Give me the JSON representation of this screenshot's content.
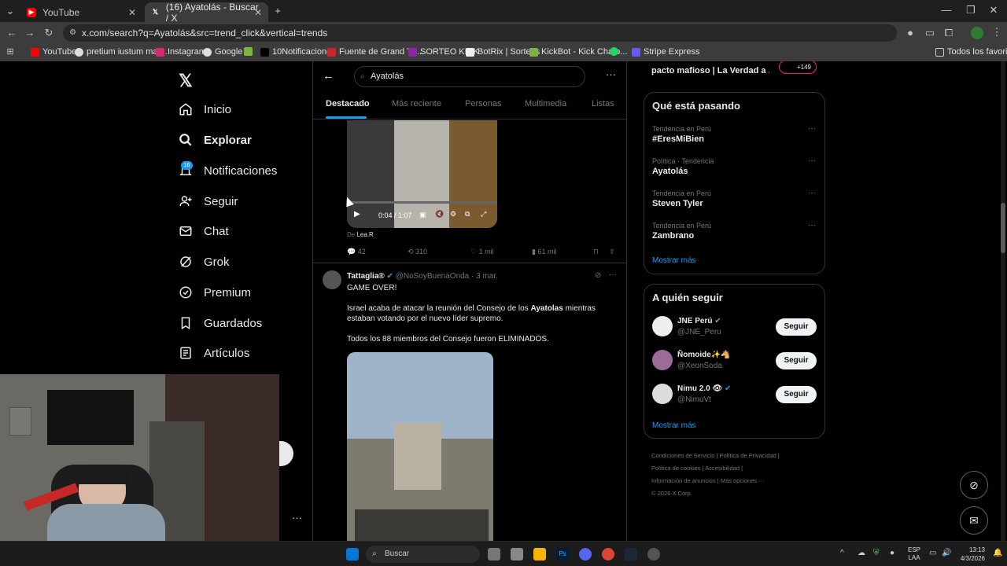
{
  "browser": {
    "tabs": [
      {
        "label": "YouTube"
      },
      {
        "label": "(16) Ayatolás - Buscar / X"
      }
    ],
    "url": "x.com/search?q=Ayatolás&src=trend_click&vertical=trends",
    "bookmarks": [
      "YouTube",
      "pretium iustum mat...",
      "Instagram",
      "Google",
      "10Notificaciones",
      "Fuente de Grand Th...",
      "SORTEO KICK",
      "BotRix | Sorteos",
      "KickBot - Kick Chatb...",
      "Stripe Express"
    ],
    "all_bookmarks": "Todos los favoritos"
  },
  "nav": {
    "items": [
      "Inicio",
      "Explorar",
      "Notificaciones",
      "Seguir",
      "Chat",
      "Grok",
      "Premium",
      "Guardados",
      "Artículos"
    ],
    "notif_badge": "16"
  },
  "search": {
    "query": "Ayatolás",
    "tabs": [
      "Destacado",
      "Más reciente",
      "Personas",
      "Multimedia",
      "Listas"
    ]
  },
  "tweet1": {
    "time": "0:04 / 1:07",
    "from_label": "De",
    "from_name": "Lea.R",
    "replies": "42",
    "retweets": "310",
    "likes": "1 mil",
    "views": "61 mil"
  },
  "tweet2": {
    "name": "Tattaglia®",
    "handle": "@NoSoyBuenaOnda",
    "date": "· 3 mar.",
    "line1": "GAME OVER!",
    "line2a": "Israel acaba de atacar la reunión del Consejo de los ",
    "line2b": "Ayatolas",
    "line2c": " mientras",
    "line3": "estaban votando por el nuevo líder supremo.",
    "line4": "Todos los 88 miembros del Consejo fueron ELIMINADOS."
  },
  "right": {
    "top_text": "pacto mafioso | La Verdad a ...",
    "top_badge": "+149",
    "trends_title": "Qué está pasando",
    "trends": [
      {
        "meta": "Tendencia en Perú",
        "name": "#EresMiBien"
      },
      {
        "meta": "Política · Tendencia",
        "name": "Ayatolás"
      },
      {
        "meta": "Tendencia en Perú",
        "name": "Steven Tyler"
      },
      {
        "meta": "Tendencia en Perú",
        "name": "Zambrano"
      }
    ],
    "show_more": "Mostrar más",
    "follow_title": "A quién seguir",
    "follow": [
      {
        "name": "JNE Perú",
        "handle": "@JNE_Peru",
        "btn": "Seguir"
      },
      {
        "name": "Ñomoide✨🐴",
        "handle": "@XeonSoda",
        "btn": "Seguir"
      },
      {
        "name": "Nimu 2.0 👁",
        "handle": "@NimuVt",
        "btn": "Seguir"
      }
    ],
    "show_more2": "Mostrar más",
    "footer": [
      "Condiciones de Servicio",
      "Política de Privacidad",
      "Política de cookies",
      "Accesibilidad",
      "Información de anuncios",
      "Más opciones ···",
      "© 2026 X Corp."
    ]
  },
  "taskbar": {
    "search": "Buscar",
    "lang1": "ESP",
    "lang2": "LAA",
    "time": "13:13",
    "date": "4/3/2026"
  }
}
